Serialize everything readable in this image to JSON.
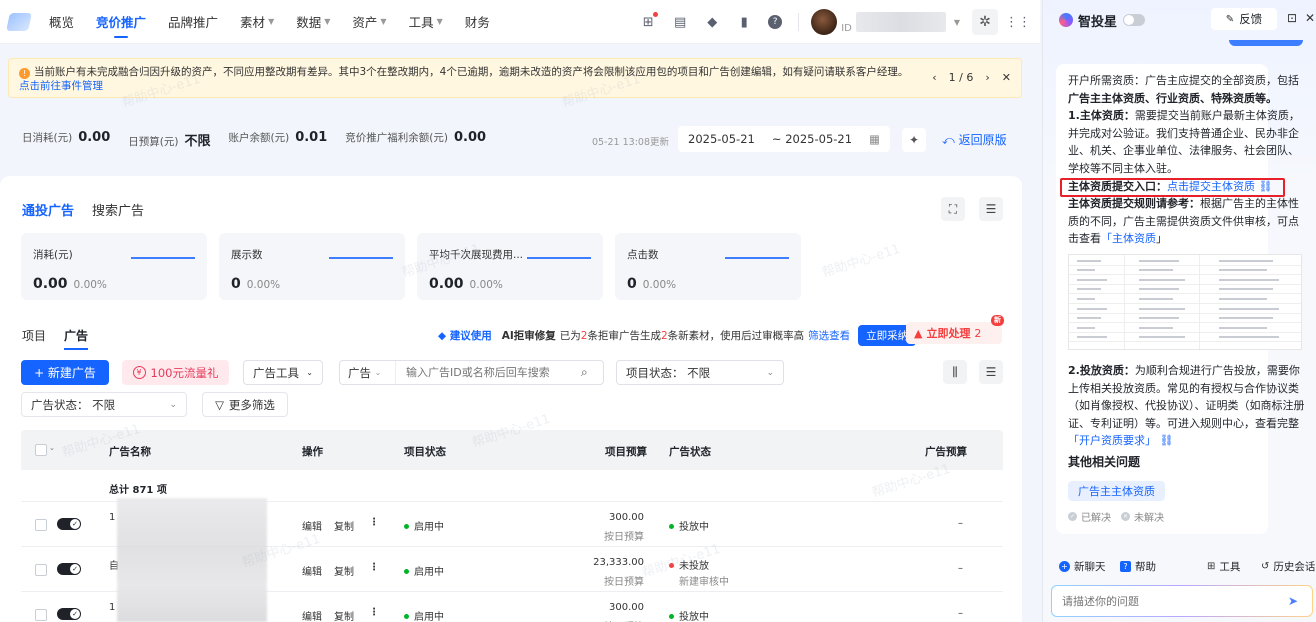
{
  "nav": {
    "items": [
      {
        "label": "概览",
        "active": false,
        "caret": false
      },
      {
        "label": "竞价推广",
        "active": true,
        "caret": false
      },
      {
        "label": "品牌推广",
        "active": false,
        "caret": false
      },
      {
        "label": "素材",
        "active": false,
        "caret": true
      },
      {
        "label": "数据",
        "active": false,
        "caret": true
      },
      {
        "label": "资产",
        "active": false,
        "caret": true
      },
      {
        "label": "工具",
        "active": false,
        "caret": true
      },
      {
        "label": "财务",
        "active": false,
        "caret": false
      }
    ],
    "id_label": "ID",
    "icons": [
      "gift-icon",
      "table-icon",
      "bell-icon",
      "document-icon",
      "help-icon",
      "puzzle-icon",
      "grid-icon"
    ]
  },
  "alert": {
    "text": "当前账户有未完成融合归因升级的资产，不同应用整改期有差异。其中3个在整改期内，4个已逾期，逾期未改造的资产将会限制该应用包的项目和广告创建编辑，如有疑问请联系客户经理。",
    "link": "点击前往事件管理",
    "page": "1 / 6"
  },
  "stats": {
    "items": [
      {
        "label": "日消耗(元)",
        "value": "0.00"
      },
      {
        "label": "日预算(元)",
        "value": "不限"
      },
      {
        "label": "账户余额(元)",
        "value": "0.01"
      },
      {
        "label": "竞价推广福利余额(元)",
        "value": "0.00"
      }
    ],
    "updated": "05-21 13:08更新",
    "date_start": "2025-05-21",
    "date_end": "~ 2025-05-21",
    "back_label": "返回原版"
  },
  "main": {
    "tabs": [
      "通投广告",
      "搜索广告"
    ],
    "metrics": [
      {
        "name": "消耗(元)",
        "value": "0.00",
        "pct": "0.00%"
      },
      {
        "name": "展示数",
        "value": "0",
        "pct": "0.00%"
      },
      {
        "name": "平均千次展现费用...",
        "value": "0.00",
        "pct": "0.00%"
      },
      {
        "name": "点击数",
        "value": "0",
        "pct": "0.00%"
      }
    ],
    "subtabs": [
      "项目",
      "广告"
    ],
    "ai": {
      "tag": "建议使用",
      "title": "AI拒审修复",
      "part1": "已为",
      "num1": "2",
      "part2": "条拒审广告生成",
      "num2": "2",
      "part3": "条新素材，使用后过审概率高",
      "link": "筛选查看",
      "button": "立即采纳"
    },
    "urgent": {
      "label": "立即处理",
      "count": "2",
      "badge": "新"
    },
    "toolbar": {
      "new_ad": "+ 新建广告",
      "gift": "100元流量礼",
      "ad_tools": "广告工具",
      "search_type": "广告",
      "search_placeholder": "输入广告ID或名称后回车搜索",
      "project_status_label": "项目状态：",
      "project_status_value": "不限",
      "ad_status_label": "广告状态：",
      "ad_status_value": "不限",
      "more_filters": "更多筛选"
    },
    "table": {
      "headers": {
        "name": "广告名称",
        "ops": "操作",
        "project_status": "项目状态",
        "project_budget": "项目预算",
        "ad_status": "广告状态",
        "ad_budget": "广告预算"
      },
      "total": "总计 871 项",
      "rows": [
        {
          "name_prefix": "1",
          "edit": "编辑",
          "copy": "复制",
          "project_status": "启用中",
          "budget": "300.00",
          "budget_type": "按日预算",
          "ad_status": "投放中",
          "ad_status_sub": "",
          "ad_status_color": "green",
          "ad_budget": "–"
        },
        {
          "name_prefix": "自",
          "edit": "编辑",
          "copy": "复制",
          "project_status": "启用中",
          "budget": "23,333.00",
          "budget_type": "按日预算",
          "ad_status": "未投放",
          "ad_status_sub": "新建审核中",
          "ad_status_color": "red",
          "ad_budget": "–"
        },
        {
          "name_prefix": "1",
          "edit": "编辑",
          "copy": "复制",
          "project_status": "启用中",
          "budget": "300.00",
          "budget_type": "按日预算",
          "ad_status": "投放中",
          "ad_status_sub": "",
          "ad_status_color": "green",
          "ad_budget": "–"
        }
      ]
    }
  },
  "assistant": {
    "title": "智投星",
    "feedback": "反馈",
    "p1_a": "开户所需资质：广告主应提交的全部资质，包括",
    "p1_b": "广告主主体资质、行业资质、特殊资质等。",
    "p2_head": "1.主体资质：",
    "p2": "需要提交当前账户最新主体资质，并完成对公验证。我们支持普通企业、民办非企业、机关、企事业单位、法律服务、社会团队、学校等不同主体入驻。",
    "entry_label": "主体资质提交入口：",
    "entry_link": "点击提交主体资质",
    "rule_label": "主体资质提交规则请参考：",
    "rule_text": "根据广告主的主体性质的不同，广告主需提供资质文件供审核，可点击查看",
    "rule_link": "「主体资质",
    "rule_end": "」",
    "p3_head": "2.投放资质：",
    "p3": "为顺利合规进行广告投放，需要你上传相关投放资质。常见的有授权与合作协议类（如肖像授权、代投协议）、证明类（如商标注册证、专利证明）等。可进入规则中心，查看完整",
    "p3_link": "「开户资质要求」",
    "other_title": "其他相关问题",
    "related": "广告主主体资质",
    "resolved": "已解决",
    "unresolved": "未解决",
    "actions": [
      "新聊天",
      "帮助",
      "工具",
      "历史会话"
    ],
    "input_placeholder": "请描述你的问题"
  },
  "watermark": "帮助中心-e11"
}
